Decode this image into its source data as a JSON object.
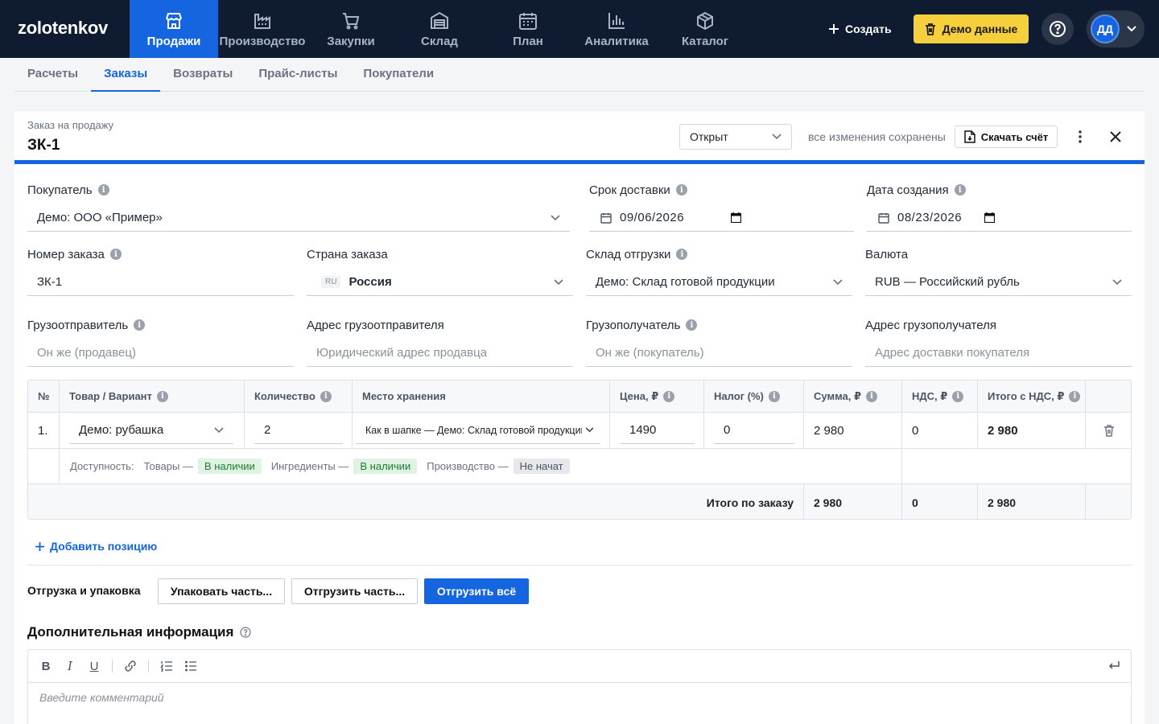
{
  "app": {
    "logo": "zolotenkov"
  },
  "nav": [
    {
      "label": "Продажи",
      "icon": "store-icon",
      "active": true
    },
    {
      "label": "Производство",
      "icon": "factory-icon"
    },
    {
      "label": "Закупки",
      "icon": "cart-icon"
    },
    {
      "label": "Склад",
      "icon": "warehouse-icon"
    },
    {
      "label": "План",
      "icon": "calendar-icon"
    },
    {
      "label": "Аналитика",
      "icon": "bar-chart-icon"
    },
    {
      "label": "Каталог",
      "icon": "box-icon"
    }
  ],
  "header": {
    "create_label": "Создать",
    "demo_label": "Демо данные",
    "avatar_initials": "ДД"
  },
  "subtabs": [
    {
      "label": "Расчеты"
    },
    {
      "label": "Заказы",
      "active": true
    },
    {
      "label": "Возвраты"
    },
    {
      "label": "Прайс-листы"
    },
    {
      "label": "Покупатели"
    }
  ],
  "doc": {
    "type": "Заказ на продажу",
    "number": "ЗК-1",
    "status": "Открыт",
    "saved": "все изменения сохранены",
    "download_label": "Скачать счёт"
  },
  "form": {
    "buyer": {
      "label": "Покупатель",
      "value": "Демо: ООО «Пример»"
    },
    "delivery_date": {
      "label": "Срок доставки",
      "value": "09/06/2026"
    },
    "created_date": {
      "label": "Дата создания",
      "value": "08/23/2026"
    },
    "order_number": {
      "label": "Номер заказа",
      "value": "ЗК-1"
    },
    "country": {
      "label": "Страна заказа",
      "code": "RU",
      "value": "Россия"
    },
    "warehouse": {
      "label": "Склад отгрузки",
      "value": "Демо: Склад готовой продукции"
    },
    "currency": {
      "label": "Валюта",
      "value": "RUB — Российский рубль"
    },
    "shipper": {
      "label": "Грузоотправитель",
      "placeholder": "Он же (продавец)"
    },
    "shipper_address": {
      "label": "Адрес грузоотправителя",
      "placeholder": "Юридический адрес продавца"
    },
    "consignee": {
      "label": "Грузополучатель",
      "placeholder": "Он же (покупатель)"
    },
    "consignee_address": {
      "label": "Адрес грузополучателя",
      "placeholder": "Адрес доставки покупателя"
    }
  },
  "table": {
    "headers": {
      "num": "№",
      "product": "Товар / Вариант",
      "qty": "Количество",
      "location": "Место хранения",
      "price": "Цена, ₽",
      "tax": "Налог (%)",
      "sum": "Сумма, ₽",
      "vat": "НДС, ₽",
      "total": "Итого с НДС, ₽"
    },
    "rows": [
      {
        "num": "1.",
        "product": "Демо: рубашка",
        "qty": "2",
        "location": "Как в шапке — Демо: Склад готовой продукции",
        "price": "1490",
        "tax": "0",
        "sum": "2 980",
        "vat": "0",
        "total": "2 980"
      }
    ],
    "availability": {
      "label": "Доступность:",
      "goods_label": "Товары —",
      "goods_status": "В наличии",
      "ingredients_label": "Ингредиенты —",
      "ingredients_status": "В наличии",
      "production_label": "Производство —",
      "production_status": "Не начат"
    },
    "totals": {
      "label": "Итого по заказу",
      "sum": "2 980",
      "vat": "0",
      "total": "2 980"
    }
  },
  "actions": {
    "add_position": "Добавить позицию",
    "shipping_label": "Отгрузка и упаковка",
    "pack_part": "Упаковать часть...",
    "ship_part": "Отгрузить часть...",
    "ship_all": "Отгрузить всё"
  },
  "additional": {
    "title": "Дополнительная информация",
    "placeholder": "Введите комментарий"
  },
  "colors": {
    "topbar": "#0f1b30",
    "accent": "#1565e0",
    "demo": "#f6cf3d",
    "in_stock_bg": "#dff3e2",
    "in_stock_text": "#1e7a32"
  }
}
